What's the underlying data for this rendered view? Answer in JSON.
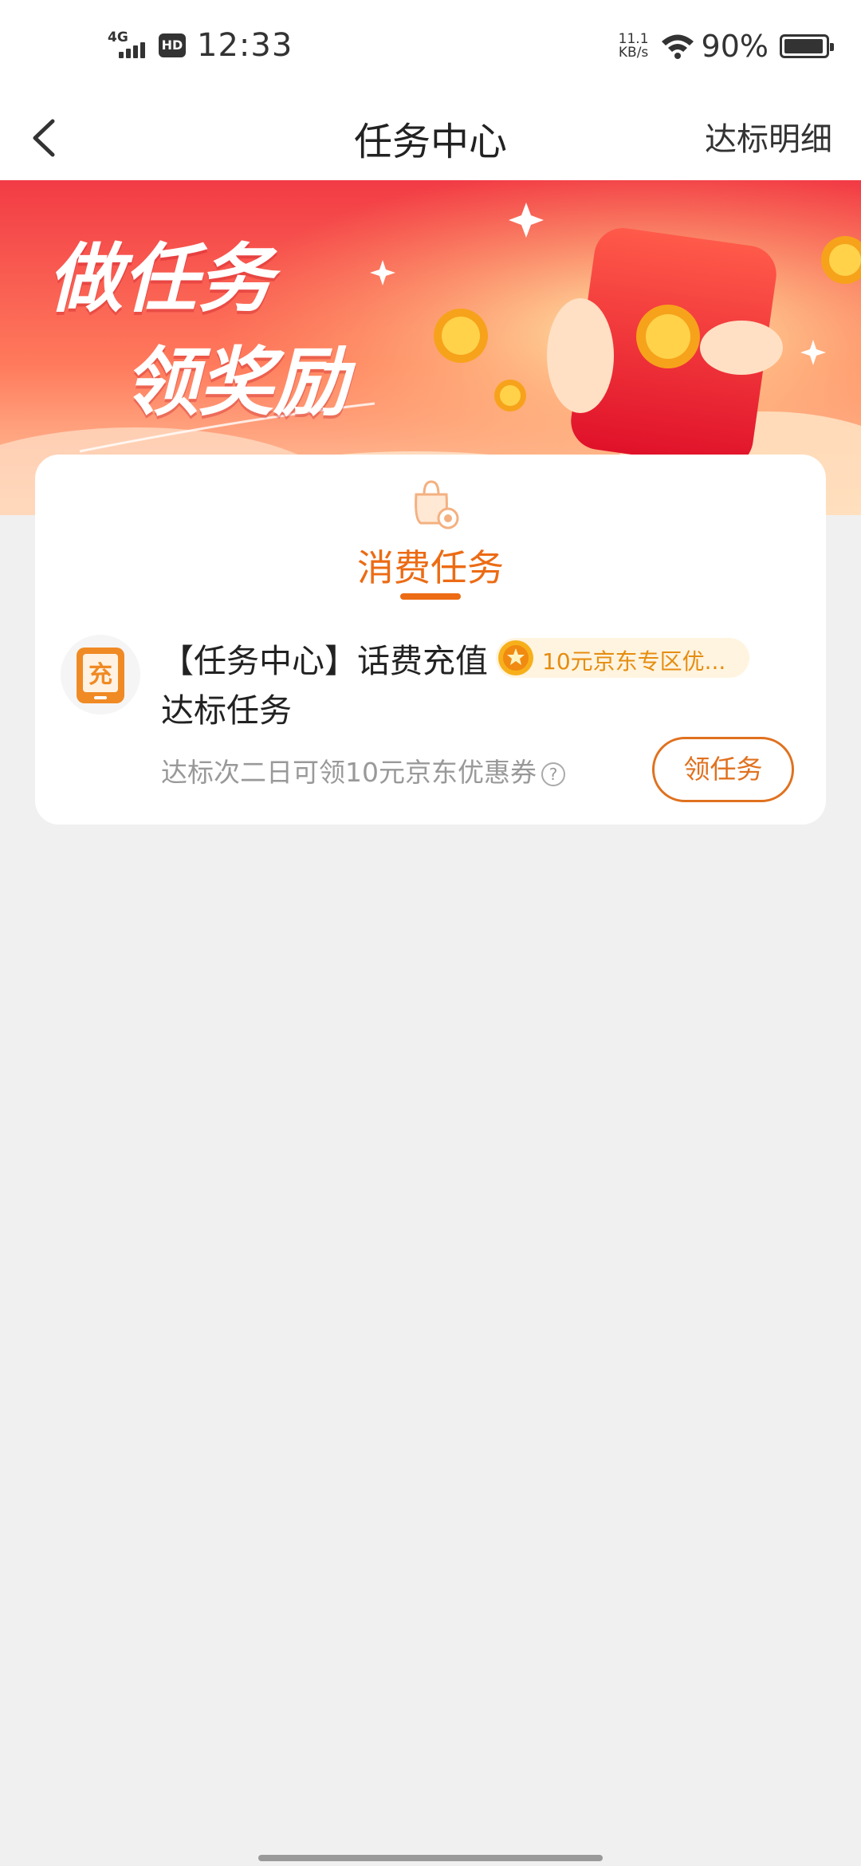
{
  "status_bar": {
    "network": "4G",
    "hd": "HD",
    "time": "12:33",
    "speed_value": "11.1",
    "speed_unit": "KB/s",
    "battery": "90%"
  },
  "nav": {
    "back_icon": "chevron-left-icon",
    "title": "任务中心",
    "right_link": "达标明细"
  },
  "banner": {
    "line1": "做任务",
    "line2": "领奖励",
    "colors": {
      "top": "#f23b45",
      "bottom": "#ffd4a8"
    }
  },
  "section": {
    "icon": "shopping-bag-icon",
    "title": "消费任务",
    "accent": "#ec6b14"
  },
  "task": {
    "icon": "recharge-icon",
    "icon_char": "充",
    "title": "【任务中心】话费充值达标任务",
    "reward": "10元京东专区优...",
    "description": "达标次二日可领10元京东优惠券",
    "help": "?",
    "button": "领任务"
  }
}
